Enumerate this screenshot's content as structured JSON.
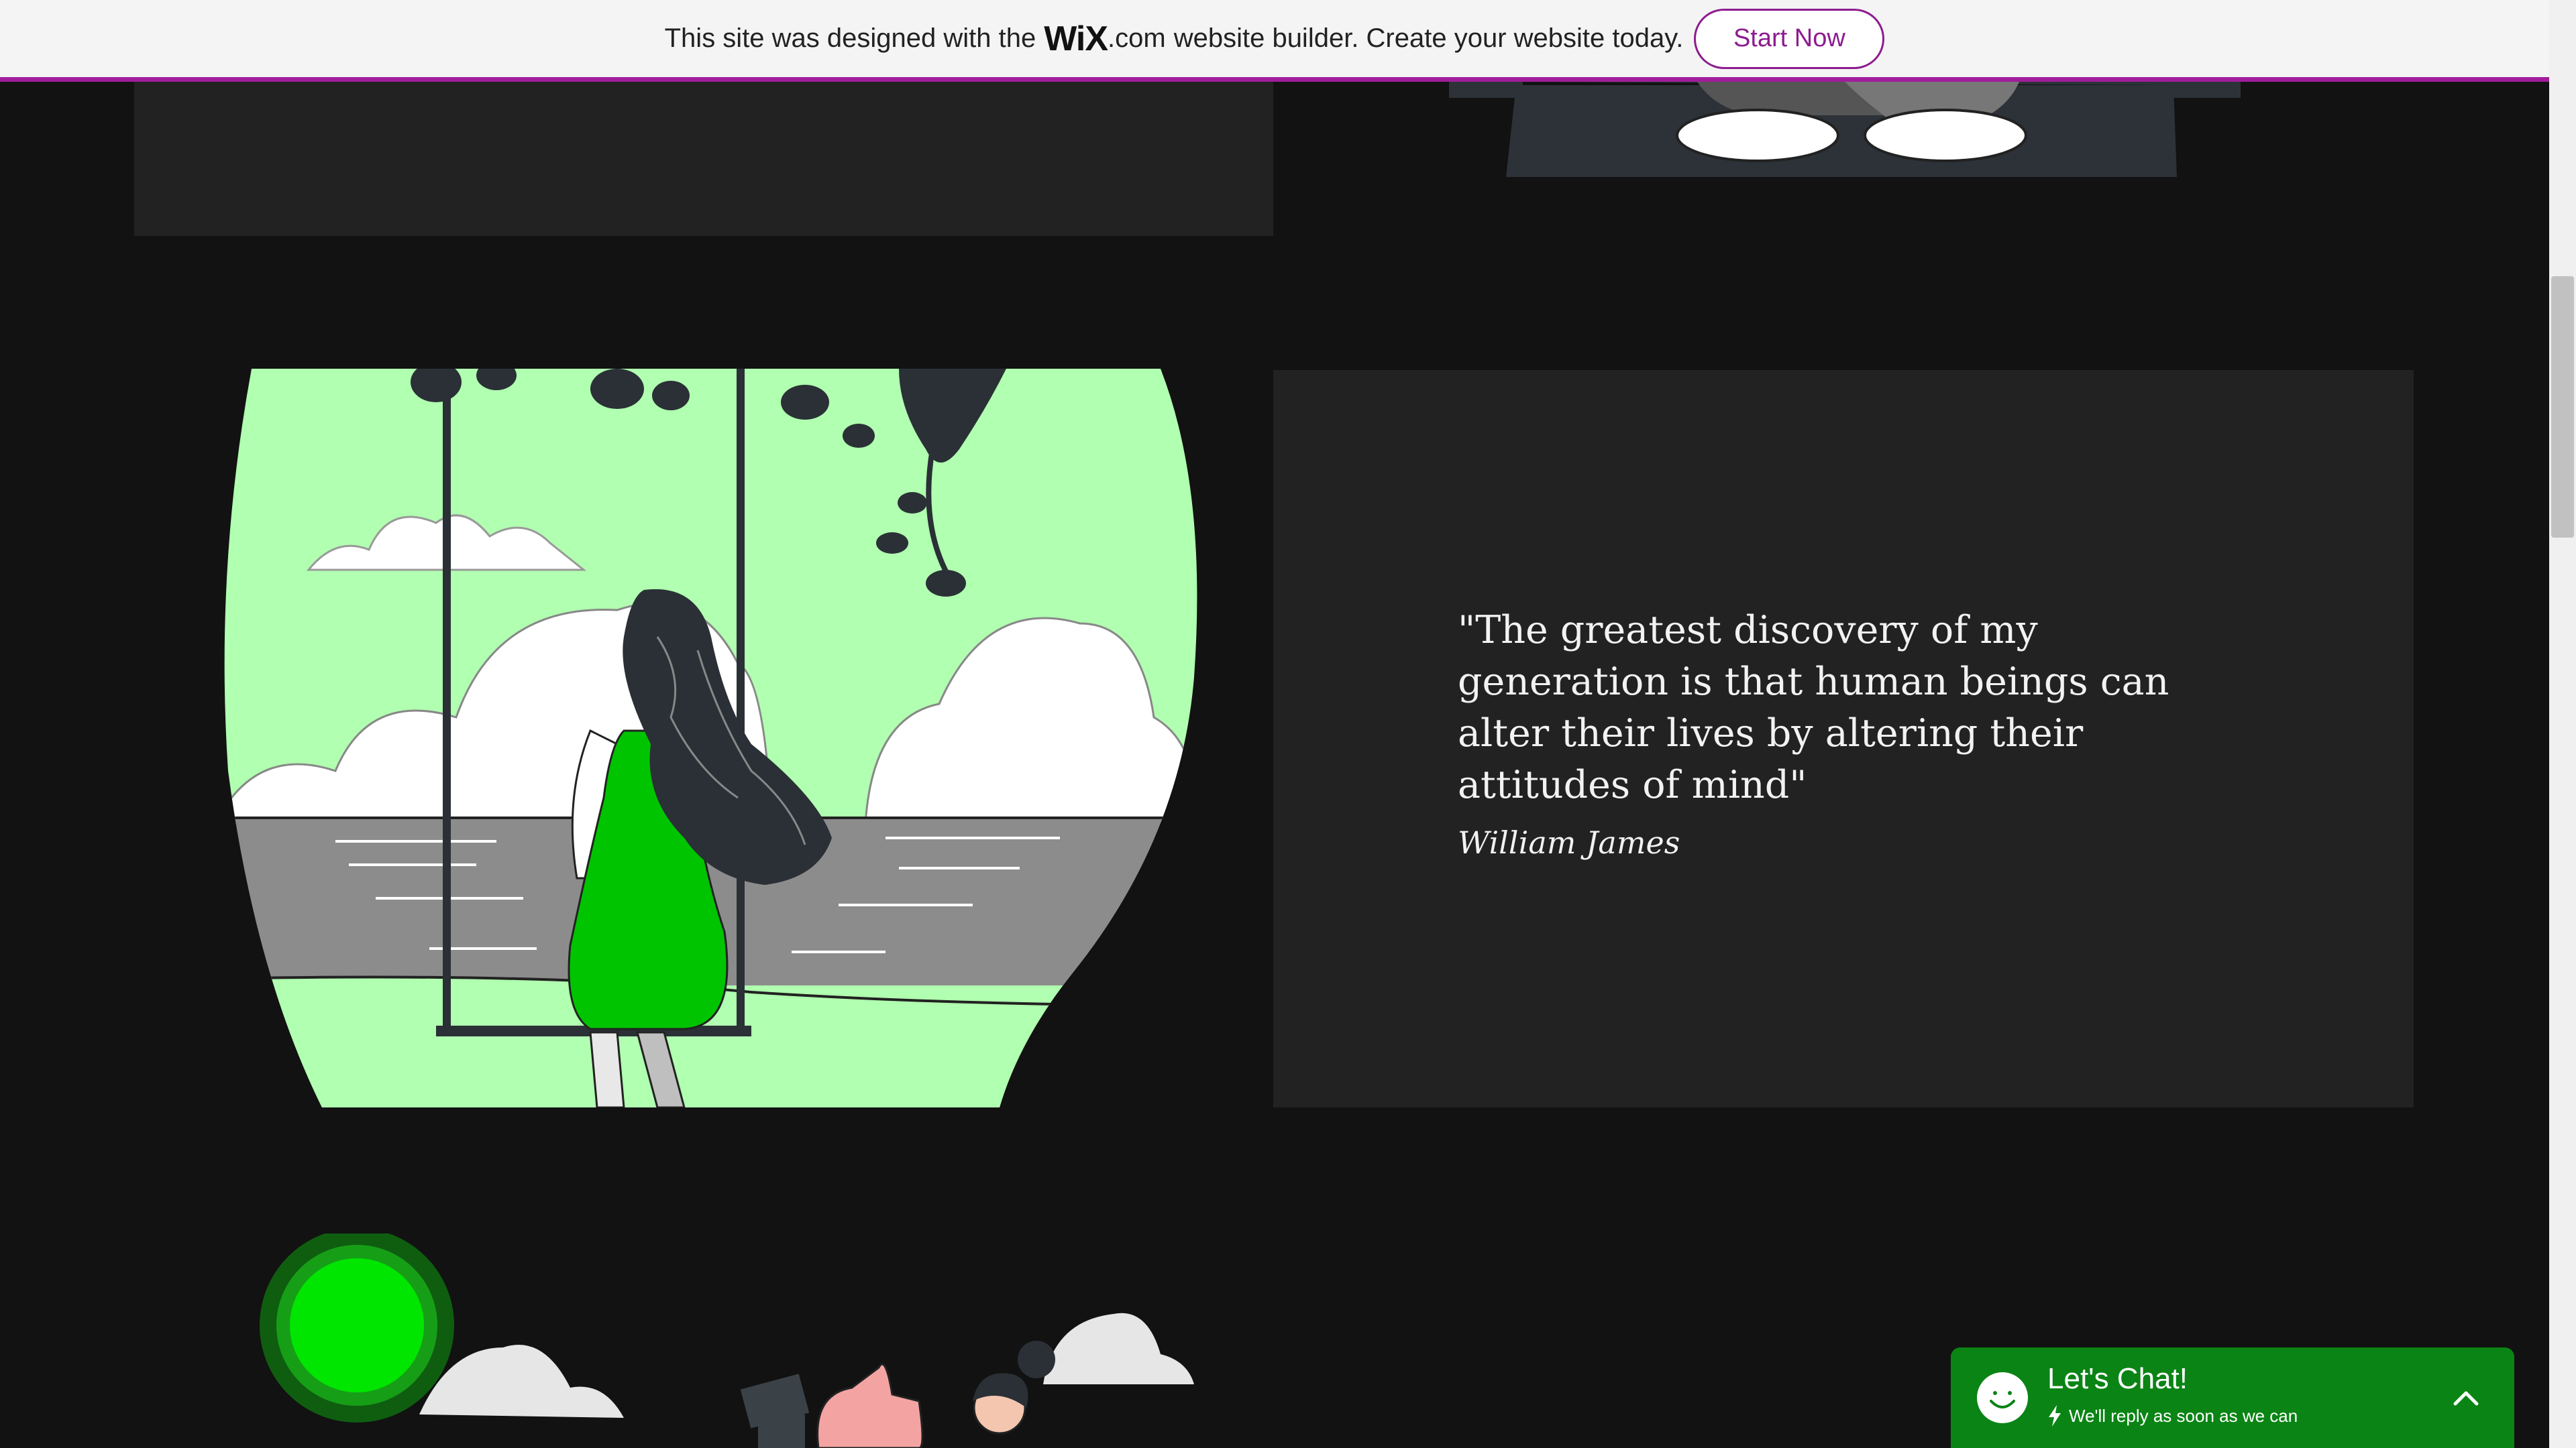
{
  "banner": {
    "text_before": "This site was designed with the",
    "logo": "WiX",
    "logo_suffix": ".com",
    "text_after": "website builder. Create your website today.",
    "button_label": "Start Now",
    "accent_color": "#a11e9b"
  },
  "quote": {
    "text": "\"The greatest discovery of my generation is that human beings can alter their lives by altering their attitudes of mind\"",
    "author": "William James"
  },
  "chat": {
    "title": "Let's Chat!",
    "subtitle": "We'll reply as soon as we can",
    "color": "#0a8414",
    "icons": [
      "smiley-icon",
      "lightning-icon",
      "chevron-up-icon"
    ]
  },
  "illustrations": {
    "top": "meditating-person-illustration",
    "middle": "woman-on-swing-illustration",
    "bottom": "thumbs-up-illustration"
  }
}
